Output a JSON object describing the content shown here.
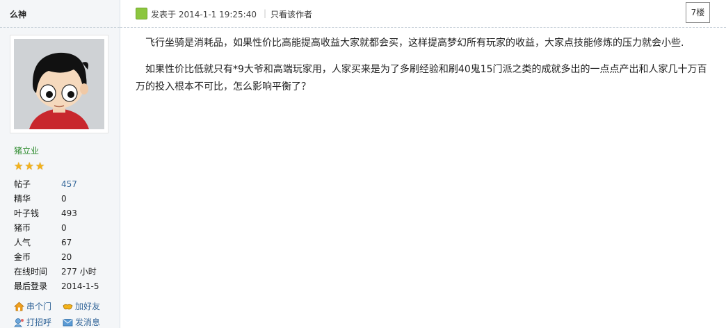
{
  "author": {
    "name": "么神",
    "usergroup": "猪立业",
    "stars": 3,
    "stats": [
      {
        "label": "帖子",
        "value": "457",
        "link": true
      },
      {
        "label": "精华",
        "value": "0",
        "link": false
      },
      {
        "label": "叶子钱",
        "value": "493",
        "link": false
      },
      {
        "label": "猪币",
        "value": "0",
        "link": false
      },
      {
        "label": "人气",
        "value": "67",
        "link": false
      },
      {
        "label": "金币",
        "value": "20",
        "link": false
      },
      {
        "label": "在线时间",
        "value": "277 小时",
        "link": false
      },
      {
        "label": "最后登录",
        "value": "2014-1-5",
        "link": false
      }
    ],
    "actions": [
      {
        "label": "串个门",
        "icon": "house-icon"
      },
      {
        "label": "加好友",
        "icon": "handshake-icon"
      },
      {
        "label": "打招呼",
        "icon": "greet-icon"
      },
      {
        "label": "发消息",
        "icon": "envelope-icon"
      }
    ]
  },
  "post": {
    "posted_at": "发表于 2014-1-1 19:25:40",
    "separator": "|",
    "only_author": "只看该作者",
    "floor": "7楼",
    "paragraphs": [
      "飞行坐骑是消耗品，如果性价比高能提高收益大家就都会买，这样提高梦幻所有玩家的收益，大家点技能修炼的压力就会小些.",
      "如果性价比低就只有*9大爷和高端玩家用，人家买来是为了多刷经验和刷40鬼15门派之类的成就多出的一点点产出和人家几十万百万的投入根本不可比，怎么影响平衡了？"
    ]
  },
  "colors": {
    "sidebar_bg": "#f4f6f8",
    "link": "#336699",
    "usergroup": "#2b8a2b",
    "star": "#f3b21a",
    "online": "#8cc63f"
  }
}
